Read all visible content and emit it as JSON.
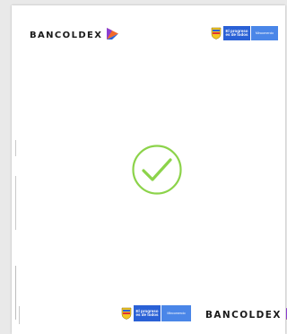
{
  "header": {
    "brand_name": "BANCOLDEX",
    "gov_slogan": "El progreso es de todos",
    "gov_ministry": "Mincomercio"
  },
  "footer": {
    "brand_name": "BANCOLDEX",
    "gov_slogan": "El progreso es de todos",
    "gov_ministry": "Mincomercio"
  },
  "status": {
    "icon": "check-circle-icon",
    "color": "#8cd34a"
  },
  "colors": {
    "brand_orange": "#f2692b",
    "brand_purple": "#8a3fd1",
    "brand_blue": "#2a61d6",
    "gov_blue": "#2a61d6",
    "gov_light_blue": "#4a86e8"
  }
}
